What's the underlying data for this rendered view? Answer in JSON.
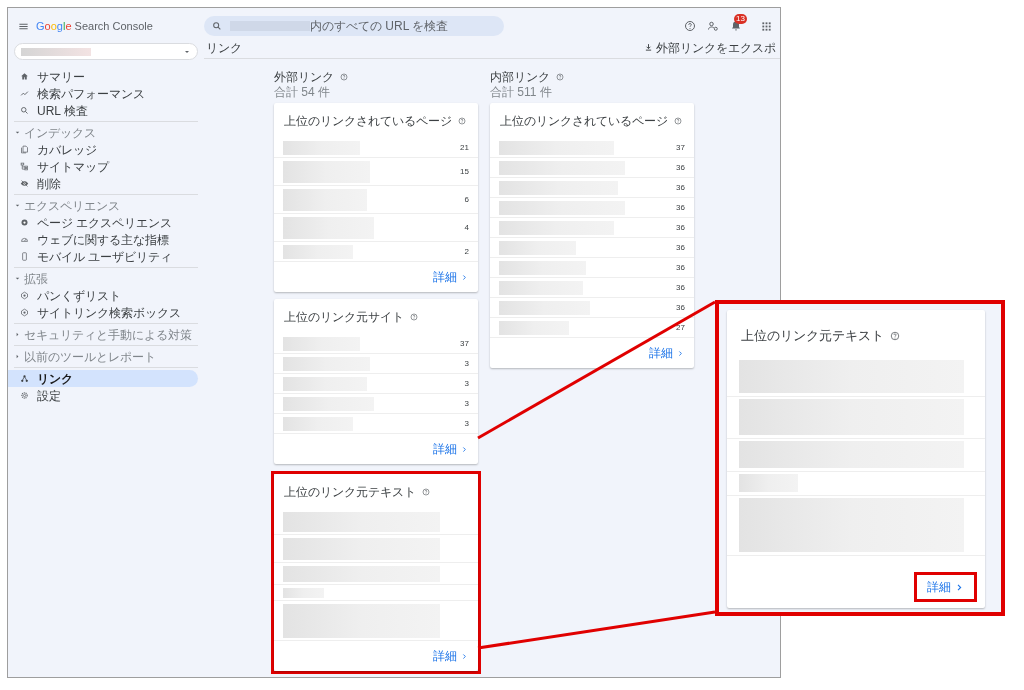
{
  "header": {
    "product": "Google Search Console",
    "search": {
      "placeholder": "内のすべての URL を検査"
    },
    "notification_badge": "13"
  },
  "sidebar": {
    "sections": [
      {
        "items": [
          {
            "label": "サマリー",
            "selected": false
          },
          {
            "label": "検索パフォーマンス",
            "selected": false
          },
          {
            "label": "URL 検査",
            "selected": false
          }
        ]
      },
      {
        "title": "インデックス",
        "expanded": true,
        "items": [
          {
            "label": "カバレッジ",
            "selected": false
          },
          {
            "label": "サイトマップ",
            "selected": false
          },
          {
            "label": "削除",
            "selected": false
          }
        ]
      },
      {
        "title": "エクスペリエンス",
        "expanded": true,
        "items": [
          {
            "label": "ページ エクスペリエンス",
            "selected": false
          },
          {
            "label": "ウェブに関する主な指標",
            "selected": false
          },
          {
            "label": "モバイル ユーザビリティ",
            "selected": false
          }
        ]
      },
      {
        "title": "拡張",
        "expanded": true,
        "items": [
          {
            "label": "パンくずリスト",
            "selected": false
          },
          {
            "label": "サイトリンク検索ボックス",
            "selected": false
          }
        ]
      },
      {
        "title": "セキュリティと手動による対策",
        "expanded": false
      },
      {
        "title": "以前のツールとレポート",
        "expanded": false
      },
      {
        "items": [
          {
            "label": "リンク",
            "selected": true
          },
          {
            "label": "設定",
            "selected": false
          }
        ]
      }
    ]
  },
  "page": {
    "title": "リンク",
    "export": "外部リンクをエクスポ"
  },
  "columns": [
    {
      "title": "外部リンク",
      "total": "合計 54 件",
      "cards": [
        {
          "title": "上位のリンクされているページ",
          "rows": [
            {
              "kind": "redacted",
              "count": "21"
            },
            {
              "kind": "redacted",
              "count": "15"
            },
            {
              "kind": "redacted",
              "count": "6"
            },
            {
              "kind": "redacted",
              "count": "4"
            },
            {
              "kind": "redacted",
              "count": "2"
            }
          ],
          "link": "詳細",
          "highlighted": false
        },
        {
          "title": "上位のリンク元サイト",
          "rows": [
            {
              "kind": "redacted",
              "count": "37"
            },
            {
              "kind": "redacted",
              "count": "3"
            },
            {
              "kind": "redacted",
              "count": "3"
            },
            {
              "kind": "redacted",
              "count": "3"
            },
            {
              "kind": "redacted",
              "count": "3"
            }
          ],
          "link": "詳細",
          "highlighted": false
        },
        {
          "title": "上位のリンク元テキスト",
          "rows": [
            {
              "kind": "redacted"
            },
            {
              "kind": "redacted"
            },
            {
              "kind": "redacted"
            },
            {
              "kind": "redacted"
            },
            {
              "kind": "redacted"
            }
          ],
          "link": "詳細",
          "highlighted": true
        }
      ]
    },
    {
      "title": "内部リンク",
      "total": "合計 511 件",
      "cards": [
        {
          "title": "上位のリンクされているページ",
          "rows": [
            {
              "kind": "redacted",
              "count": "37"
            },
            {
              "kind": "redacted",
              "count": "36"
            },
            {
              "kind": "redacted",
              "count": "36"
            },
            {
              "kind": "redacted",
              "count": "36"
            },
            {
              "kind": "redacted",
              "count": "36"
            },
            {
              "kind": "redacted",
              "count": "36"
            },
            {
              "kind": "redacted",
              "count": "36"
            },
            {
              "kind": "redacted",
              "count": "36"
            },
            {
              "kind": "redacted",
              "count": "36"
            },
            {
              "kind": "redacted",
              "count": "27"
            }
          ],
          "link": "詳細",
          "highlighted": false
        }
      ]
    }
  ],
  "callout": {
    "title": "上位のリンク元テキスト",
    "rows": [
      {
        "kind": "redacted"
      },
      {
        "kind": "redacted"
      },
      {
        "kind": "redacted"
      },
      {
        "kind": "redacted"
      },
      {
        "kind": "redacted"
      }
    ],
    "link": "詳細"
  }
}
